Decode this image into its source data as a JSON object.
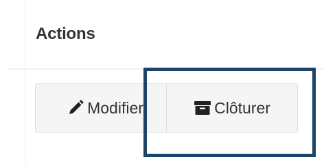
{
  "panel": {
    "title": "Actions"
  },
  "actions": {
    "edit_label": "Modifier",
    "close_label": "Clôturer"
  },
  "icons": {
    "edit": "pencil-icon",
    "close": "archive-icon"
  },
  "colors": {
    "highlight_border": "#1b4466",
    "button_background": "#f5f5f5",
    "button_border": "#dcdcdc",
    "text": "#333333"
  }
}
